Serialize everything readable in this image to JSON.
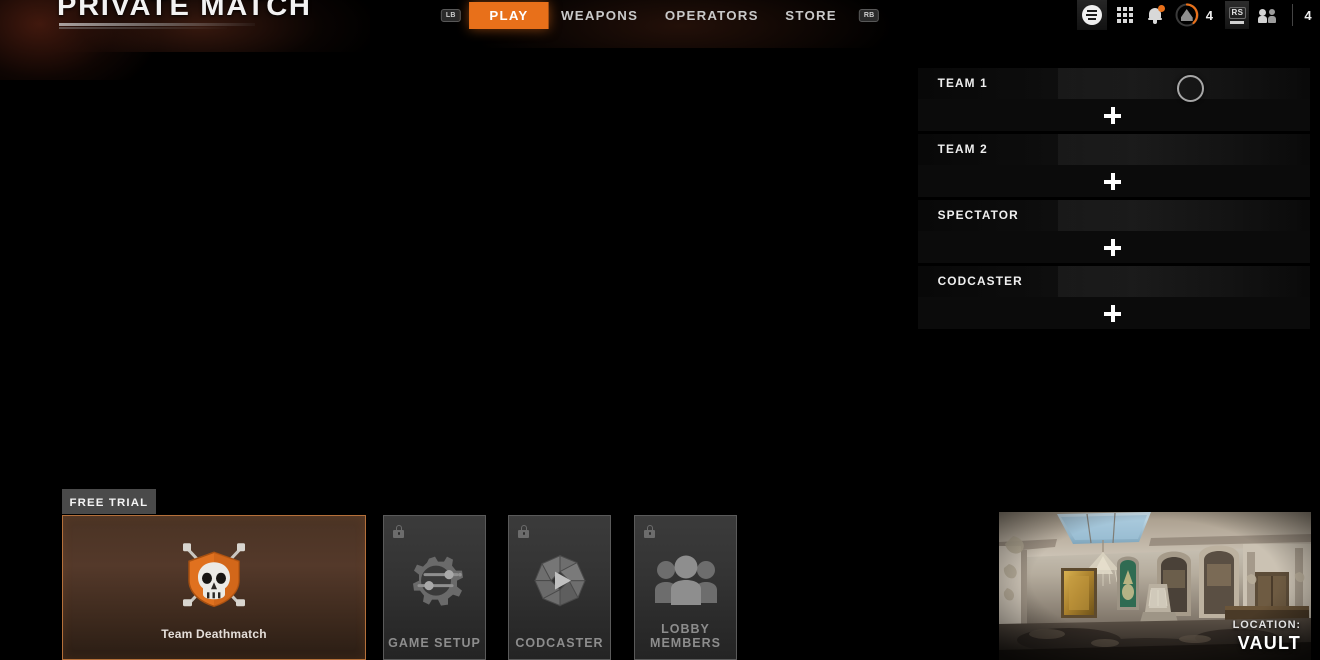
{
  "header": {
    "title": "PRIVATE MATCH",
    "left_bumper": "LB",
    "right_bumper": "RB",
    "nav": [
      {
        "label": "PLAY",
        "active": true
      },
      {
        "label": "WEAPONS",
        "active": false
      },
      {
        "label": "OPERATORS",
        "active": false
      },
      {
        "label": "STORE",
        "active": false
      }
    ],
    "right_cluster": {
      "menu_icon": "hamburger-menu-icon",
      "apps_icon": "grid-apps-icon",
      "notifications_icon": "bell-icon",
      "currency_icon": "cod-points-icon",
      "currency_value": "4",
      "stick_button": "RS",
      "party_icon": "party-members-icon",
      "party_value": "4"
    }
  },
  "roster": {
    "groups": [
      {
        "label": "TEAM 1",
        "add_label": "+"
      },
      {
        "label": "TEAM 2",
        "add_label": "+"
      },
      {
        "label": "SPECTATOR",
        "add_label": "+"
      },
      {
        "label": "CODCASTER",
        "add_label": "+"
      }
    ]
  },
  "bottom": {
    "badge": "FREE TRIAL",
    "cards": [
      {
        "label": "Team Deathmatch",
        "icon": "skull-crossed-swords-emblem",
        "locked": false,
        "selected": true
      },
      {
        "label": "GAME SETUP",
        "icon": "gear-sliders-icon",
        "locked": true,
        "selected": false
      },
      {
        "label": "CODCASTER",
        "icon": "camera-shutter-play-icon",
        "locked": true,
        "selected": false
      },
      {
        "label": "LOBBY MEMBERS",
        "icon": "group-people-icon",
        "locked": true,
        "selected": false
      }
    ]
  },
  "map": {
    "location_label": "LOCATION:",
    "location_name": "VAULT"
  },
  "colors": {
    "accent": "#e8701a",
    "selected_card_border": "#b5703a",
    "panel_bg": "#0b0b0b",
    "text_primary": "#efefef",
    "text_muted": "#8d8d8d"
  }
}
